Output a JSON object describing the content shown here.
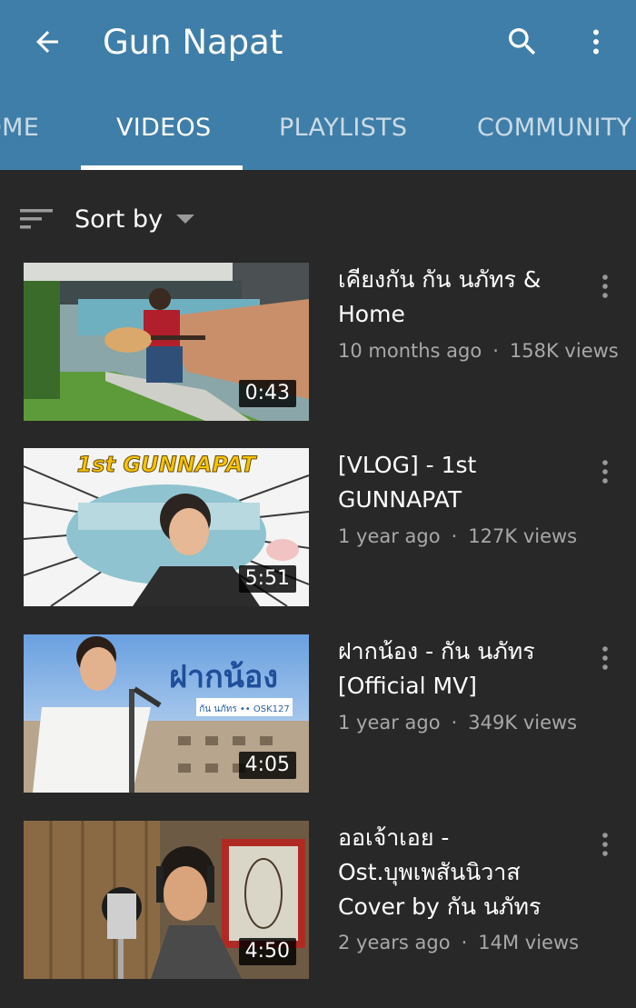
{
  "header": {
    "title": "Gun Napat",
    "background_color": "#3f7ea8",
    "back_icon": "arrow-back-icon",
    "search_icon": "search-icon",
    "more_icon": "more-vert-icon"
  },
  "tabs": [
    {
      "label": "HOME",
      "active": false
    },
    {
      "label": "VIDEOS",
      "active": true
    },
    {
      "label": "PLAYLISTS",
      "active": false
    },
    {
      "label": "COMMUNITY",
      "active": false
    }
  ],
  "sort": {
    "label": "Sort by",
    "icon": "sort-icon"
  },
  "videos": [
    {
      "title": "เคียงกัน กัน นภัทร & Home",
      "age": "10 months ago",
      "views": "158K views",
      "duration": "0:43"
    },
    {
      "title": "[VLOG] - 1st GUNNAPAT",
      "age": "1 year ago",
      "views": "127K views",
      "duration": "5:51",
      "thumb_text": "1st GUNNAPAT"
    },
    {
      "title": "ฝากน้อง - กัน นภัทร [Official MV]",
      "age": "1 year ago",
      "views": "349K views",
      "duration": "4:05",
      "thumb_text": "ฝากน้อง",
      "thumb_subtext": "กัน นภัทร •• OSK127"
    },
    {
      "title": "ออเจ้าเอย - Ost.บุพเพสันนิวาส Cover by กัน นภัทร",
      "age": "2 years ago",
      "views": "14M views",
      "duration": "4:50"
    }
  ],
  "meta_separator": "·",
  "colors": {
    "page_background": "#282828",
    "meta_text": "#a8a8a8",
    "header_background": "#3f7ea8"
  }
}
